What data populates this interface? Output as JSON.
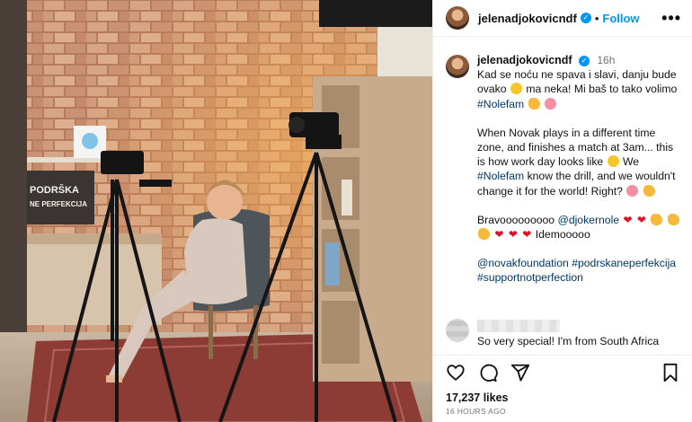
{
  "author": {
    "username": "jelenadjokovicndf",
    "follow_label": "Follow",
    "separator": "•",
    "more_label": "•••"
  },
  "post": {
    "time": "16h",
    "paragraph1": "Kad se noću ne spava i slavi, danju bude ovako",
    "paragraph1_b": "ma neka! Mi baš to tako volimo",
    "paragraph1_tag": "#Nolefam",
    "paragraph2_a": "When Novak plays in a different time zone, and finishes a match at 3am... this is how work day looks like",
    "paragraph2_b": "We",
    "paragraph2_tag": "#Nolefam",
    "paragraph2_c": "know the drill, and we wouldn't change it for the world! Right?",
    "bravo": "Bravooooooooo",
    "bravo_mention": "@djokernole",
    "idemo": "Idemooooo",
    "tag1": "@novakfoundation",
    "tag2": "#podrskaneperfekcija",
    "tag3": "#supportnotperfection"
  },
  "comment": {
    "text": "So very special! I'm from South Africa"
  },
  "footer": {
    "likes": "17,237 likes",
    "time_ago": "16 HOURS AGO"
  },
  "photo": {
    "sign_text_line1": "PODRŠKA",
    "sign_text_line2": "NE PERFEKCIJA"
  },
  "colors": {
    "accent": "#0095f6",
    "link": "#00376b",
    "heart": "#e0102a"
  }
}
